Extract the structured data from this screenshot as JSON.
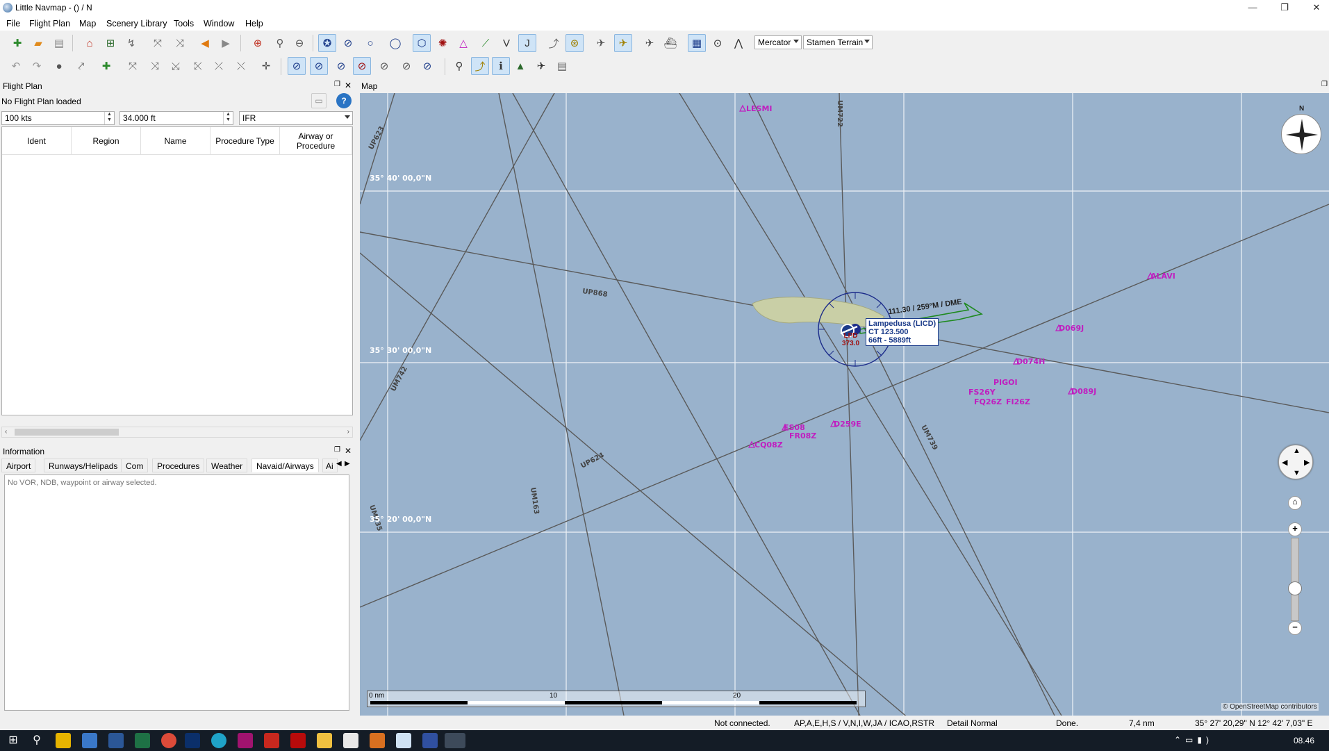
{
  "window": {
    "title": "Little Navmap - () / N",
    "minimize": "—",
    "maximize": "❐",
    "close": "✕"
  },
  "menu": [
    "File",
    "Flight Plan",
    "Map",
    "Scenery Library",
    "Tools",
    "Window",
    "Help"
  ],
  "toolbar": {
    "projection": "Mercator",
    "theme": "Stamen Terrain"
  },
  "flight_plan_panel": {
    "title": "Flight Plan",
    "status": "No Flight Plan loaded",
    "speed": "100 kts",
    "altitude": "34.000 ft",
    "flight_type": "IFR",
    "columns": [
      "Ident",
      "Region",
      "Name",
      "Procedure Type",
      "Airway or Procedure"
    ]
  },
  "info_panel": {
    "title": "Information",
    "tabs": [
      "Airport",
      "Runways/Helipads",
      "Com",
      "Procedures",
      "Weather",
      "Navaid/Airways",
      "Ai"
    ],
    "message": "No VOR, NDB, waypoint or airway selected."
  },
  "map": {
    "title": "Map",
    "latitudes": [
      "35° 40' 00,0\"N",
      "35° 30' 00,0\"N",
      "35° 20' 00,0\"N"
    ],
    "waypoints": [
      "LESMI",
      "ALAVI",
      "D069J",
      "D074H",
      "D089J",
      "PIGOI",
      "FS26Y",
      "FQ26Z",
      "FI26Z",
      "FS08",
      "FR08Z",
      "CQ08Z",
      "D259E"
    ],
    "airways": [
      "UP868",
      "UM742",
      "UP623",
      "UM722",
      "UM739",
      "UM163",
      "UP624",
      "UM735"
    ],
    "airport_label": "Lampedusa (LICD)",
    "airport_info": [
      "CT 123.500",
      "66ft - 5889ft"
    ],
    "vor_label": "LPD",
    "vor_freq": "373.0",
    "ils_label": "111.30 / 259°M / DME",
    "scale_labels": [
      "0 nm",
      "10",
      "20"
    ],
    "attribution": "© OpenStreetMap contributors",
    "compass_north": "N"
  },
  "status_bar": {
    "connection": "Not connected.",
    "filters": "AP,A,E,H,S / V,N,I,W,JA / ICAO,RSTR",
    "detail": "Detail Normal",
    "state": "Done.",
    "distance": "7,4 nm",
    "coordinates": "35° 27' 20,29\" N 12° 42' 7,03\" E"
  },
  "taskbar": {
    "clock": "08.46"
  }
}
